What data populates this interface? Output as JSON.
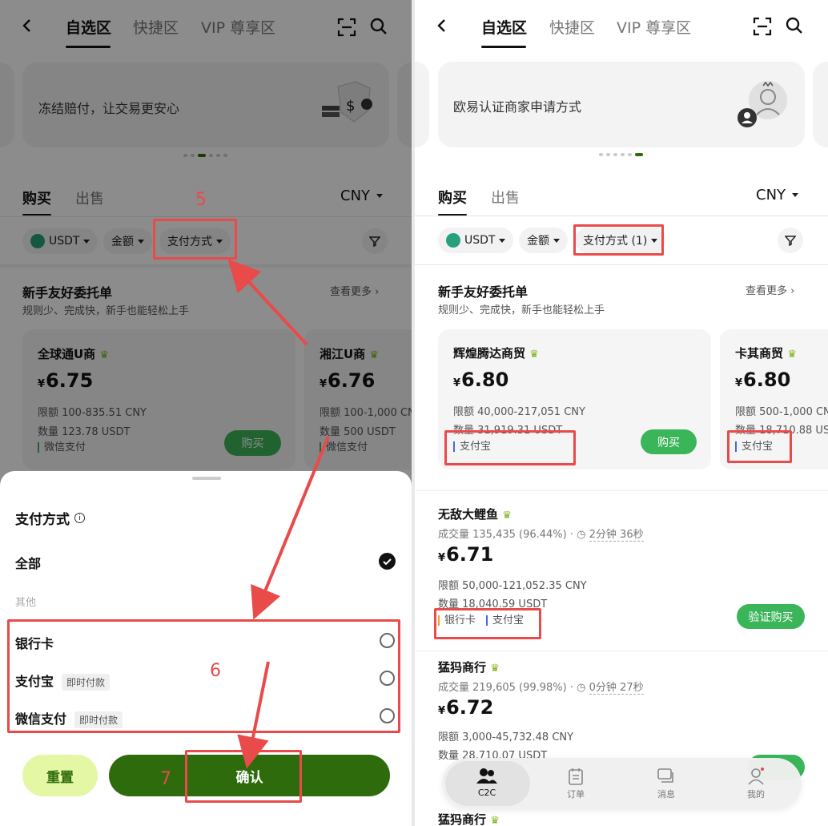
{
  "left": {
    "tabs": [
      "自选区",
      "快捷区",
      "VIP 尊享区"
    ],
    "banner_text": "冻结赔付，让交易更安心",
    "trade_tabs": [
      "购买",
      "出售"
    ],
    "currency": "CNY",
    "filters": {
      "coin": "USDT",
      "amount": "金额",
      "payment": "支付方式"
    },
    "section_title": "新手友好委托单",
    "section_subtitle": "规则少、完成快，新手也能轻松上手",
    "view_more": "查看更多",
    "cards": [
      {
        "name": "全球通U商",
        "price": "6.75",
        "limit": "限额 100-835.51 CNY",
        "qty": "数量 123.78 USDT",
        "pay": "微信支付",
        "btn": "购买"
      },
      {
        "name": "湘江U商",
        "price": "6.76",
        "limit": "限额 100-1,000 CN",
        "qty": "数量 500 USDT",
        "pay": "微信支付"
      }
    ],
    "sheet": {
      "title": "支付方式",
      "all": "全部",
      "other": "其他",
      "options": [
        {
          "label": "银行卡",
          "tag": ""
        },
        {
          "label": "支付宝",
          "tag": "即时付款"
        },
        {
          "label": "微信支付",
          "tag": "即时付款"
        }
      ],
      "reset": "重置",
      "confirm": "确认"
    },
    "annotations": {
      "step5": "5",
      "step6": "6",
      "step7": "7"
    }
  },
  "right": {
    "tabs": [
      "自选区",
      "快捷区",
      "VIP 尊享区"
    ],
    "banner_text": "欧易认证商家申请方式",
    "trade_tabs": [
      "购买",
      "出售"
    ],
    "currency": "CNY",
    "filters": {
      "coin": "USDT",
      "amount": "金额",
      "payment": "支付方式 (1)"
    },
    "section_title": "新手友好委托单",
    "section_subtitle": "规则少、完成快，新手也能轻松上手",
    "view_more": "查看更多",
    "cards": [
      {
        "name": "辉煌腾达商贸",
        "price": "6.80",
        "limit": "限额 40,000-217,051 CNY",
        "qty": "数量 31,919.31 USDT",
        "pay": "支付宝",
        "btn": "购买"
      },
      {
        "name": "卡其商贸",
        "price": "6.80",
        "limit": "限额 500-1,000 CN",
        "qty": "数量 18,710.88 US",
        "pay": "支付宝"
      }
    ],
    "list": [
      {
        "name": "无敌大鲤鱼",
        "stats": "成交量 135,435 (96.44%)",
        "time": "2分钟 36秒",
        "price": "6.71",
        "limit": "限额 50,000-121,052.35 CNY",
        "qty": "数量 18,040.59 USDT",
        "pays": [
          "银行卡",
          "支付宝"
        ],
        "btn": "验证购买"
      },
      {
        "name": "猛犸商行",
        "stats": "成交量 219,605 (99.98%)",
        "time": "0分钟 27秒",
        "price": "6.72",
        "limit": "限额 3,000-45,732.48 CNY",
        "qty": "数量 28,710.07 USDT"
      },
      {
        "name": "猛犸商行"
      }
    ],
    "nav": [
      "C2C",
      "订单",
      "消息",
      "我的"
    ]
  },
  "colors": {
    "brand_green": "#2e6b0c",
    "buy_green": "#3bb55a",
    "annotation_red": "#e94a4a"
  }
}
